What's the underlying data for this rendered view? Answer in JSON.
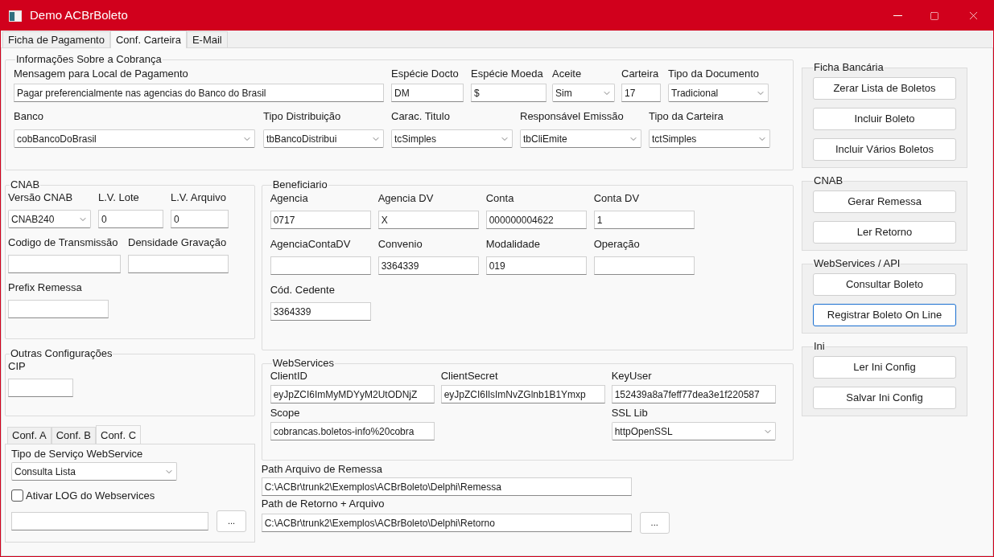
{
  "window": {
    "title": "Demo ACBrBoleto"
  },
  "tabs": [
    {
      "label": "Ficha de Pagamento",
      "selected": false
    },
    {
      "label": "Conf. Carteira",
      "selected": true
    },
    {
      "label": "E-Mail",
      "selected": false
    }
  ],
  "cobranca": {
    "title": "Informações Sobre a Cobrança",
    "fields": [
      {
        "label": "Mensagem para Local de Pagamento",
        "value": "Pagar preferencialmente nas agencias do Banco do Brasil",
        "kind": "text"
      },
      {
        "label": "Espécie Docto",
        "value": "DM",
        "kind": "text"
      },
      {
        "label": "Espécie Moeda",
        "value": "$",
        "kind": "text"
      },
      {
        "label": "Aceite",
        "value": "Sim",
        "kind": "select"
      },
      {
        "label": "Carteira",
        "value": "17",
        "kind": "text"
      },
      {
        "label": "Tipo da Documento",
        "value": "Tradicional",
        "kind": "select"
      },
      {
        "label": "Banco",
        "value": "cobBancoDoBrasil",
        "kind": "select"
      },
      {
        "label": "Tipo Distribuição",
        "value": "tbBancoDistribui",
        "kind": "select"
      },
      {
        "label": "Carac. Titulo",
        "value": "tcSimples",
        "kind": "select"
      },
      {
        "label": "Responsável Emissão",
        "value": "tbCliEmite",
        "kind": "select"
      },
      {
        "label": "Tipo da Carteira",
        "value": "tctSimples",
        "kind": "select"
      }
    ]
  },
  "cnab": {
    "title": "CNAB",
    "rows": [
      [
        {
          "label": "Versão CNAB",
          "value": "CNAB240",
          "kind": "select"
        },
        {
          "label": "L.V. Lote",
          "value": "0",
          "kind": "text"
        },
        {
          "label": "L.V. Arquivo",
          "value": "0",
          "kind": "text"
        }
      ],
      [
        {
          "label": "Codigo de Transmissão",
          "kind": "text"
        },
        {
          "label": "Densidade Gravação",
          "kind": "text"
        }
      ],
      [
        {
          "label": "Prefix Remessa",
          "kind": "text"
        }
      ]
    ]
  },
  "outras": {
    "title": "Outras Configurações",
    "fields": [
      {
        "label": "CIP",
        "kind": "text"
      }
    ]
  },
  "conf_tabs": [
    {
      "label": "Conf. A",
      "selected": false
    },
    {
      "label": "Conf. B",
      "selected": false
    },
    {
      "label": "Conf. C",
      "selected": true
    }
  ],
  "conf_c": {
    "service": {
      "label": "Tipo de Serviço WebService",
      "value": "Consulta Lista",
      "kind": "select"
    },
    "log": {
      "label": "Ativar LOG do Webservices",
      "checked": false
    },
    "log_path": {
      "kind": "text"
    },
    "browse": "..."
  },
  "beneficiario": {
    "title": "Beneficiario",
    "rows": [
      [
        {
          "label": "Agencia",
          "value": "0717",
          "kind": "text"
        },
        {
          "label": "Agencia DV",
          "value": "X",
          "kind": "text"
        },
        {
          "label": "Conta",
          "value": "000000004622",
          "kind": "text"
        },
        {
          "label": "Conta DV",
          "value": "1",
          "kind": "text"
        }
      ],
      [
        {
          "label": "AgenciaContaDV",
          "kind": "text"
        },
        {
          "label": "Convenio",
          "value": "3364339",
          "kind": "text"
        },
        {
          "label": "Modalidade",
          "value": "019",
          "kind": "text"
        },
        {
          "label": "Operação",
          "kind": "text"
        }
      ],
      [
        {
          "label": "Cód. Cedente",
          "value": "3364339",
          "kind": "text"
        }
      ]
    ]
  },
  "webservices": {
    "title": "WebServices",
    "fields": [
      {
        "label": "ClientID",
        "value": "eyJpZCI6ImMyMDYyM2UtODNjZ",
        "kind": "text"
      },
      {
        "label": "ClientSecret",
        "value": "eyJpZCI6IlsImNvZGlnb1B1Ymxp",
        "kind": "text"
      },
      {
        "label": "KeyUser",
        "value": "152439a8a7feff77dea3e1f220587",
        "kind": "text"
      },
      {
        "label": "Scope",
        "value": "cobrancas.boletos-info%20cobra",
        "kind": "text"
      },
      {
        "label": "SSL Lib",
        "value": "httpOpenSSL",
        "kind": "select"
      }
    ]
  },
  "paths": [
    {
      "label": "Path Arquivo de Remessa",
      "value": "C:\\ACBr\\trunk2\\Exemplos\\ACBrBoleto\\Delphi\\Remessa",
      "kind": "text"
    },
    {
      "label": "Path de Retorno + Arquivo",
      "value": "C:\\ACBr\\trunk2\\Exemplos\\ACBrBoleto\\Delphi\\Retorno",
      "kind": "text",
      "browse": "..."
    }
  ],
  "right_groups": [
    {
      "title": "Ficha Bancária",
      "buttons": [
        {
          "label": "Zerar Lista de Boletos",
          "focused": false
        },
        {
          "label": "Incluir Boleto",
          "focused": false
        },
        {
          "label": "Incluir Vários Boletos",
          "focused": false
        }
      ]
    },
    {
      "title": "CNAB",
      "buttons": [
        {
          "label": "Gerar Remessa",
          "focused": false
        },
        {
          "label": "Ler Retorno",
          "focused": false
        }
      ]
    },
    {
      "title": "WebServices / API",
      "buttons": [
        {
          "label": "Consultar Boleto",
          "focused": false
        },
        {
          "label": "Registrar Boleto On Line",
          "focused": true
        }
      ]
    },
    {
      "title": "Ini",
      "buttons": [
        {
          "label": "Ler Ini Config",
          "focused": false
        },
        {
          "label": "Salvar Ini Config",
          "focused": false
        }
      ]
    }
  ]
}
